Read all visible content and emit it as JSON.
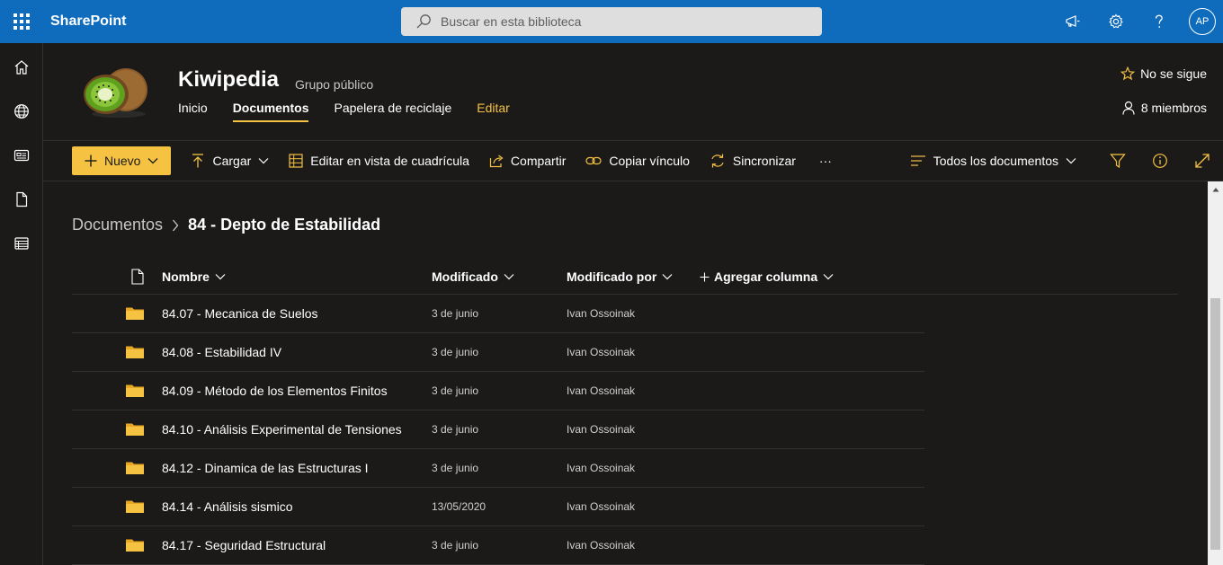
{
  "suite": {
    "app_name": "SharePoint",
    "search_placeholder": "Buscar en esta biblioteca",
    "avatar_initials": "AP"
  },
  "site": {
    "title": "Kiwipedia",
    "subtitle": "Grupo público",
    "nav": [
      "Inicio",
      "Documentos",
      "Papelera de reciclaje",
      "Editar"
    ],
    "active_nav": "Documentos",
    "follow_label": "No se sigue",
    "members_label": "8 miembros"
  },
  "commands": {
    "new_label": "Nuevo",
    "upload_label": "Cargar",
    "grid_edit_label": "Editar en vista de cuadrícula",
    "share_label": "Compartir",
    "copy_link_label": "Copiar vínculo",
    "sync_label": "Sincronizar",
    "more_label": "···",
    "view_label": "Todos los documentos"
  },
  "breadcrumb": {
    "parent": "Documentos",
    "current": "84 - Depto de Estabilidad"
  },
  "list": {
    "columns": {
      "name": "Nombre",
      "modified": "Modificado",
      "modified_by": "Modificado por",
      "add_column": "Agregar columna"
    },
    "rows": [
      {
        "name": "84.07 - Mecanica de Suelos",
        "modified": "3 de junio",
        "modified_by": "Ivan Ossoinak"
      },
      {
        "name": "84.08 - Estabilidad IV",
        "modified": "3 de junio",
        "modified_by": "Ivan Ossoinak"
      },
      {
        "name": "84.09 - Método de los Elementos Finitos",
        "modified": "3 de junio",
        "modified_by": "Ivan Ossoinak"
      },
      {
        "name": "84.10 - Análisis Experimental de Tensiones",
        "modified": "3 de junio",
        "modified_by": "Ivan Ossoinak"
      },
      {
        "name": "84.12 - Dinamica de las Estructuras I",
        "modified": "3 de junio",
        "modified_by": "Ivan Ossoinak"
      },
      {
        "name": "84.14 - Análisis sismico",
        "modified": "13/05/2020",
        "modified_by": "Ivan Ossoinak"
      },
      {
        "name": "84.17 - Seguridad Estructural",
        "modified": "3 de junio",
        "modified_by": "Ivan Ossoinak"
      }
    ]
  },
  "colors": {
    "suitebar": "#0f6cbd",
    "background": "#1b1a19",
    "accent": "#f5c242",
    "folder": "#f5c242"
  }
}
